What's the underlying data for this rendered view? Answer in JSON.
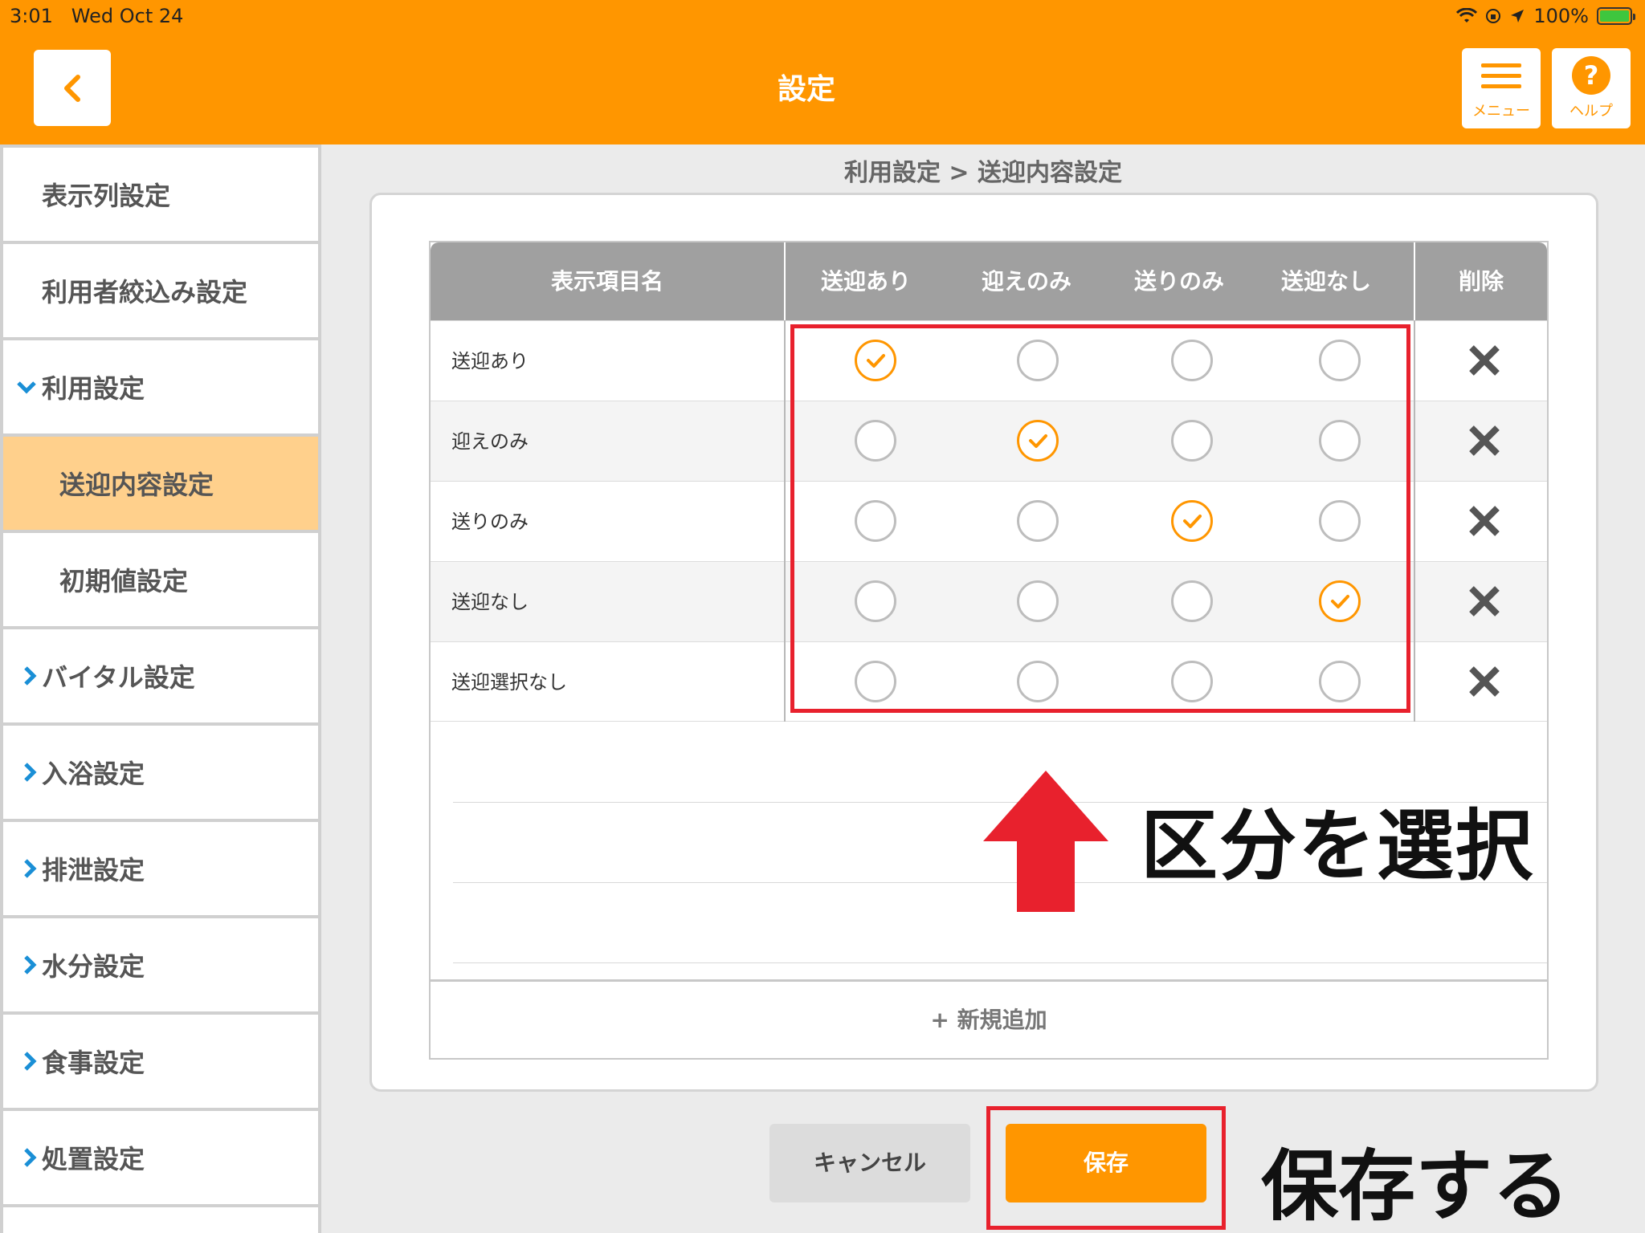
{
  "status_bar": {
    "time": "3:01",
    "date": "Wed Oct 24",
    "battery": "100%"
  },
  "header": {
    "title": "設定",
    "menu_label": "メニュー",
    "help_label": "ヘルプ",
    "help_symbol": "?"
  },
  "sidebar": {
    "items": [
      {
        "label": "表示列設定"
      },
      {
        "label": "利用者絞込み設定"
      },
      {
        "label": "利用設定"
      },
      {
        "label": "送迎内容設定"
      },
      {
        "label": "初期値設定"
      },
      {
        "label": "バイタル設定"
      },
      {
        "label": "入浴設定"
      },
      {
        "label": "排泄設定"
      },
      {
        "label": "水分設定"
      },
      {
        "label": "食事設定"
      },
      {
        "label": "処置設定"
      }
    ]
  },
  "main": {
    "breadcrumb": "利用設定 > 送迎内容設定",
    "table": {
      "headers": [
        "表示項目名",
        "送迎あり",
        "迎えのみ",
        "送りのみ",
        "送迎なし",
        "削除"
      ],
      "rows": [
        {
          "name": "送迎あり",
          "selected": 0
        },
        {
          "name": "迎えのみ",
          "selected": 1
        },
        {
          "name": "送りのみ",
          "selected": 2
        },
        {
          "name": "送迎なし",
          "selected": 3
        },
        {
          "name": "送迎選択なし",
          "selected": -1
        }
      ]
    },
    "add_button": "+ 新規追加",
    "cancel_button": "キャンセル",
    "save_button": "保存"
  },
  "annotations": {
    "select_category": "区分を選択",
    "save": "保存する"
  },
  "colors": {
    "accent": "#ff9600",
    "highlight": "#e8212d",
    "sidebar_active": "#ffd08c",
    "header_gray": "#a0a0a0"
  }
}
